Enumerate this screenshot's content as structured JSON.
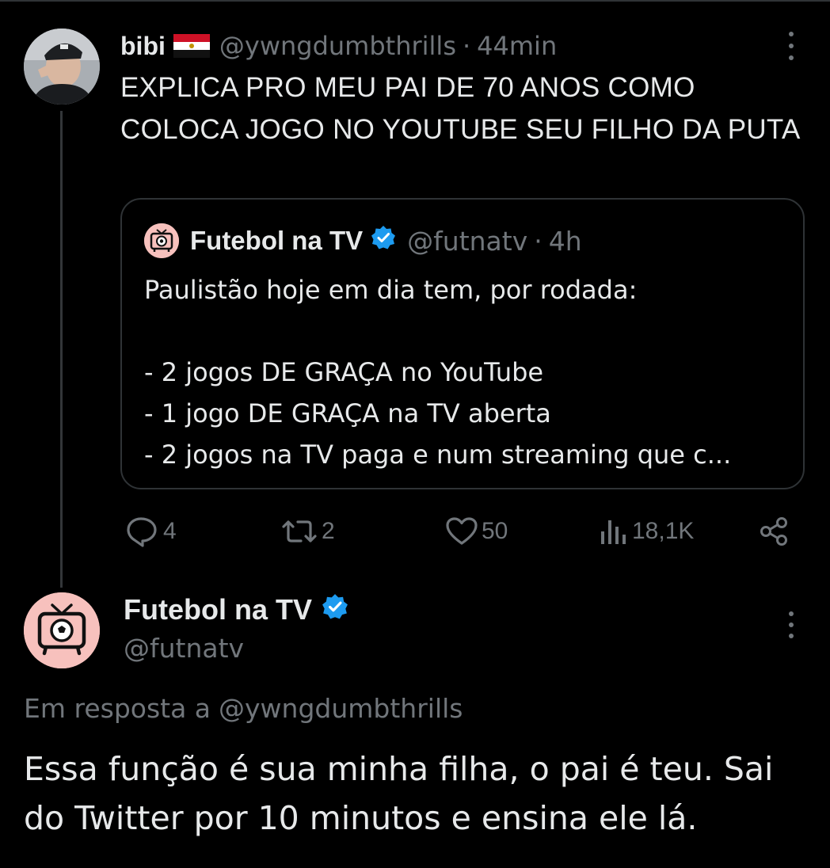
{
  "quoted_reply": {
    "author_name": "bibi",
    "author_flag": "flag-egypt",
    "author_handle": "@ywngdumbthrills",
    "separator": "·",
    "time": "44min",
    "text": "EXPLICA PRO MEU PAI DE 70 ANOS COMO COLOCA JOGO NO YOUTUBE SEU FILHO DA PUTA",
    "quoted_tweet": {
      "author_name": "Futebol na TV",
      "author_handle": "@futnatv",
      "separator": "·",
      "time": "4h",
      "text": "Paulistão hoje em dia tem, por rodada:\n\n- 2 jogos DE GRAÇA no YouTube\n- 1 jogo DE GRAÇA na TV aberta\n- 2 jogos na TV paga e num streaming que c..."
    },
    "actions": {
      "replies": "4",
      "retweets": "2",
      "likes": "50",
      "views": "18,1K"
    }
  },
  "main_tweet": {
    "author_name": "Futebol na TV",
    "author_handle": "@futnatv",
    "replying_to_label": "Em resposta a",
    "replying_to_handle": "@ywngdumbthrills",
    "text": "Essa função é sua minha filha, o pai é teu. Sai do Twitter por 10 minutos e ensina ele lá."
  },
  "colors": {
    "background": "#000000",
    "text_primary": "#e7e9ea",
    "text_secondary": "#71767b",
    "border": "#2f3336",
    "verified_blue": "#1d9bf0",
    "avatar_pink": "#f7c1bd"
  }
}
